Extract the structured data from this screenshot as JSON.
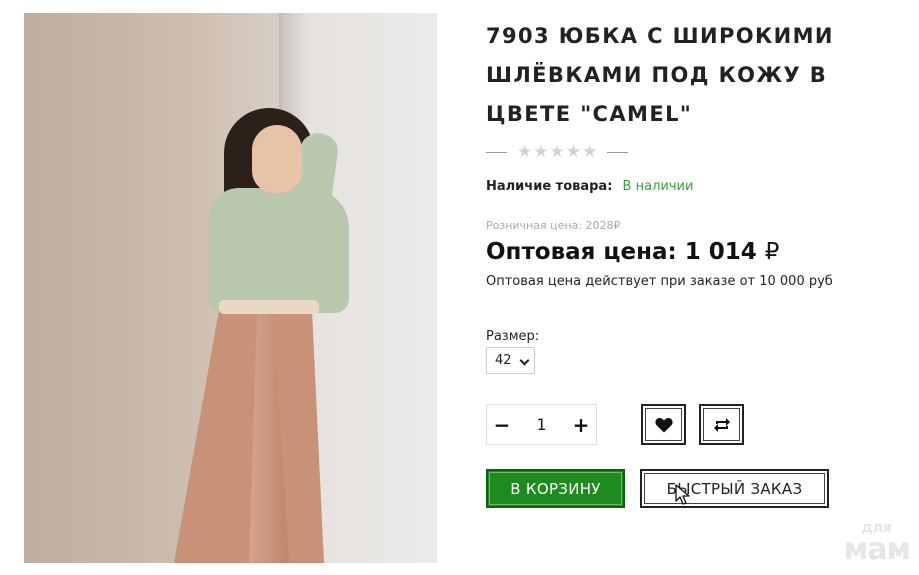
{
  "product": {
    "title": "7903 ЮБКА С ШИРОКИМИ ШЛЁВКАМИ ПОД КОЖУ В ЦВЕТЕ \"CAMEL\"",
    "rating": {
      "value": 0,
      "max": 5
    },
    "availability_label": "Наличие товара:",
    "availability_value": "В наличии",
    "retail_price_text": "Розничная цена: 2028₽",
    "wholesale_label": "Оптовая цена: 1 014",
    "currency_symbol": "₽",
    "wholesale_note": "Оптовая цена действует при заказе от 10 000 руб"
  },
  "size": {
    "label": "Размер:",
    "selected": "42"
  },
  "quantity": {
    "minus": "−",
    "value": "1",
    "plus": "+"
  },
  "buttons": {
    "add_to_cart": "В КОРЗИНУ",
    "quick_order": "БЫСТРЫЙ ЗАКАЗ"
  },
  "icons": {
    "wishlist": "heart-icon",
    "compare": "compare-arrows-icon",
    "rating": "star-icon"
  },
  "watermark": {
    "line1": "для",
    "line2": "мам"
  },
  "colors": {
    "accent_green": "#1f8a1f",
    "in_stock": "#3aa23a",
    "star_empty": "#d3d3d3"
  }
}
